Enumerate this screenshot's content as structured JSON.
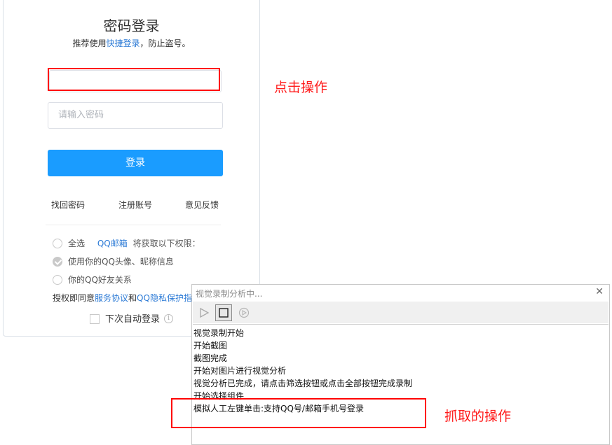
{
  "login": {
    "title": "密码登录",
    "subtitle_prefix": "推荐使用",
    "subtitle_link": "快捷登录",
    "subtitle_suffix": "，防止盗号。",
    "account_value": "",
    "password_placeholder": "请输入密码",
    "login_button": "登录",
    "links": {
      "forgot": "找回密码",
      "register": "注册账号",
      "feedback": "意见反馈"
    },
    "permissions": {
      "select_all": "全选",
      "app_name": "QQ邮箱",
      "request_text": "将获取以下权限：",
      "items": [
        {
          "label": "使用你的QQ头像、昵称信息",
          "checked": true
        },
        {
          "label": "你的QQ好友关系",
          "checked": false
        }
      ]
    },
    "agreement": {
      "prefix": "授权即同意",
      "service": "服务协议",
      "and": "和",
      "privacy": "QQ隐私保护指"
    },
    "auto_login": "下次自动登录"
  },
  "annotations": {
    "click_action": "点击操作",
    "captured_action": "抓取的操作",
    "color": "#ff0000"
  },
  "recorder": {
    "title": "视觉录制分析中...",
    "toolbar": {
      "play_icon": "play-icon",
      "stop_icon": "stop-icon",
      "record_icon": "record-icon"
    },
    "log": [
      "视觉录制开始",
      "开始截图",
      "截图完成",
      "开始对图片进行视觉分析",
      "视觉分析已完成，请点击筛选按钮或点击全部按钮完成录制",
      "开始选择组件",
      "模拟人工左键单击:支持QQ号/邮箱手机号登录"
    ]
  },
  "colors": {
    "primary_button": "#1a9cff",
    "link": "#2d7bd6"
  }
}
